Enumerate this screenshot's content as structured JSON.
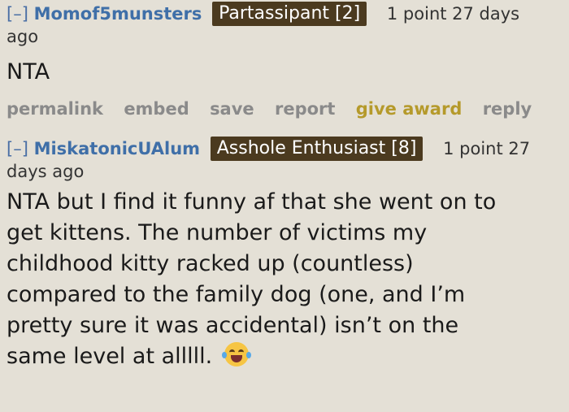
{
  "comments": [
    {
      "toggle": "[–]",
      "author": "Momof5munsters",
      "flair": "Partassipant [2]",
      "score": "1 point 27 days",
      "age_wrap": "ago",
      "body": "NTA",
      "buttons": [
        "permalink",
        "embed",
        "save",
        "report",
        "give award",
        "reply"
      ]
    },
    {
      "toggle": "[–]",
      "author": "MiskatonicUAlum",
      "flair": "Asshole Enthusiast [8]",
      "score": "1 point 27",
      "age_wrap": "days ago",
      "body_lines": [
        "NTA but I find it funny af that she went on to",
        "get kittens. The number of victims my",
        "childhood kitty racked up (countless)",
        "compared to the family dog (one, and I’m",
        "pretty sure it was accidental) isn’t on the",
        "same level at alllll."
      ]
    }
  ],
  "colors": {
    "background": "#e4e0d6",
    "author": "#3f6fa8",
    "flair_bg": "#4b3a1f",
    "award": "#b59a2b"
  },
  "emoji_icon": "face-with-tears-of-joy-icon"
}
